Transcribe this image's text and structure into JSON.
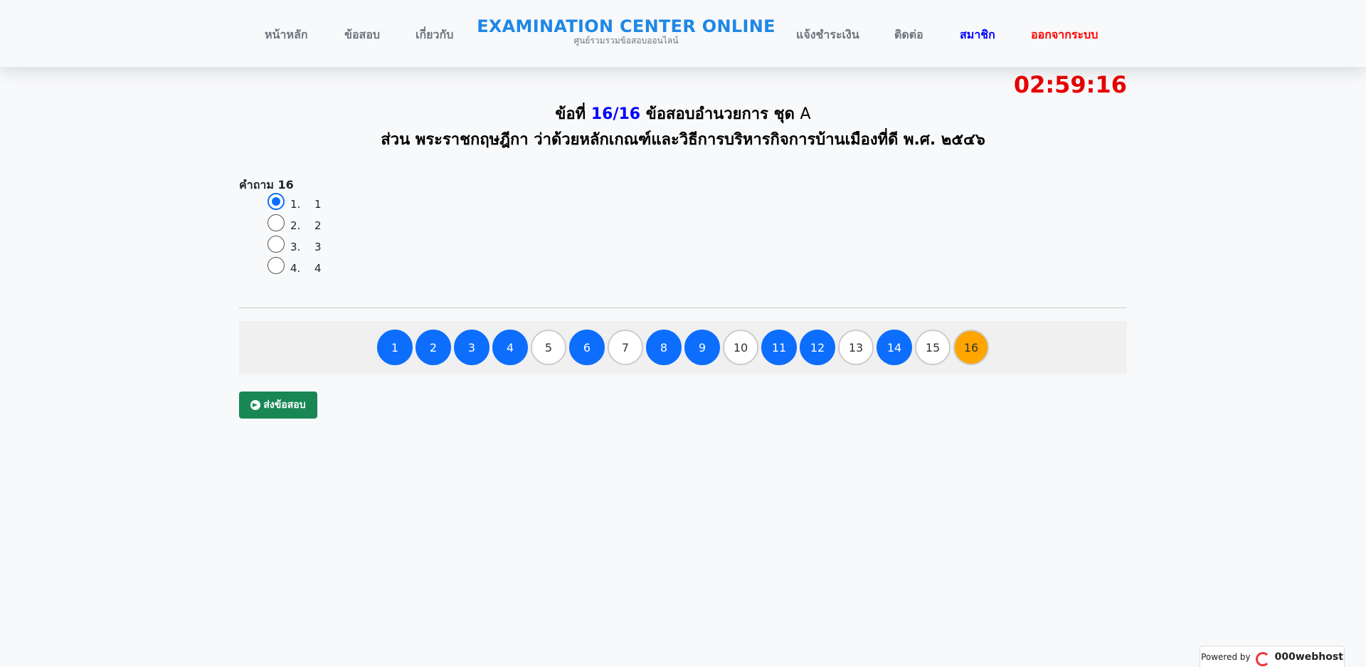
{
  "nav": {
    "home": "หน้าหลัก",
    "exam": "ข้อสอบ",
    "about": "เกี่ยวกับ",
    "payment": "แจ้งชำระเงิน",
    "contact": "ติดต่อ",
    "member": "สมาชิก",
    "logout": "ออกจากระบบ"
  },
  "brand": {
    "title": "EXAMINATION CENTER ONLINE",
    "subtitle": "ศูนย์รวมรวมข้อสอบออนไลน์"
  },
  "timer": "02:59:16",
  "heading": {
    "prefix": "ข้อที่",
    "number": "16/16",
    "exam_name": "ข้อสอบอำนวยการ ชุด",
    "set": "A",
    "section": "ส่วน พระราชกฤษฎีกา ว่าด้วยหลักเกณฑ์และวิธีการบริหารกิจการบ้านเมืองที่ดี พ.ศ. ๒๕๔๖"
  },
  "question": {
    "label": "คำถาม 16",
    "choices": [
      {
        "idx": "1.",
        "text": "1",
        "selected": true
      },
      {
        "idx": "2.",
        "text": "2",
        "selected": false
      },
      {
        "idx": "3.",
        "text": "3",
        "selected": false
      },
      {
        "idx": "4.",
        "text": "4",
        "selected": false
      }
    ]
  },
  "pages": [
    {
      "label": "1",
      "state": "answered"
    },
    {
      "label": "2",
      "state": "answered"
    },
    {
      "label": "3",
      "state": "answered"
    },
    {
      "label": "4",
      "state": "answered"
    },
    {
      "label": "5",
      "state": "unanswered"
    },
    {
      "label": "6",
      "state": "answered"
    },
    {
      "label": "7",
      "state": "unanswered"
    },
    {
      "label": "8",
      "state": "answered"
    },
    {
      "label": "9",
      "state": "answered"
    },
    {
      "label": "10",
      "state": "unanswered"
    },
    {
      "label": "11",
      "state": "answered"
    },
    {
      "label": "12",
      "state": "answered"
    },
    {
      "label": "13",
      "state": "unanswered"
    },
    {
      "label": "14",
      "state": "answered"
    },
    {
      "label": "15",
      "state": "unanswered"
    },
    {
      "label": "16",
      "state": "current"
    }
  ],
  "submit_label": "ส่งข้อสอบ",
  "powered": {
    "label": "Powered by",
    "host": "000webhost"
  },
  "colors": {
    "brand": "#1e88e5",
    "timer": "#e60000",
    "answered": "#0d6efd",
    "current": "#ffa500",
    "submit": "#198754"
  },
  "icons": {
    "submit": "arrow-circle-right-icon",
    "host_logo": "000webhost-logo-icon"
  }
}
